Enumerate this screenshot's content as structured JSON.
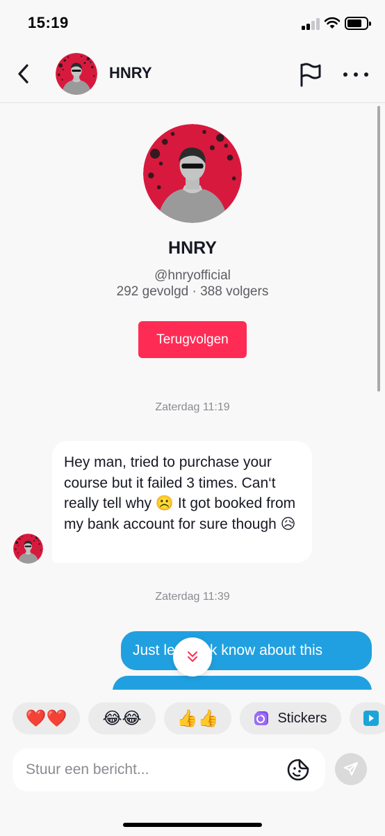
{
  "status_bar": {
    "time": "15:19"
  },
  "header": {
    "back_icon": "chevron-left-icon",
    "name": "HNRY",
    "flag_icon": "flag-icon",
    "more_icon": "more-horizontal-icon"
  },
  "profile": {
    "name": "HNRY",
    "handle": "@hnryofficial",
    "stats": "292 gevolgd · 388 volgers",
    "follow_back_label": "Terugvolgen"
  },
  "messages": {
    "timestamp_1": "Zaterdag 11:19",
    "incoming_text": "Hey man, tried to purchase your course but it failed 3 times. Can‘t really tell why ☹️ It got booked from my bank account for sure though 😥",
    "timestamp_2": "Zaterdag 11:39",
    "outgoing_1_text": "Just let tiktok know about this"
  },
  "quick_reactions": {
    "hearts": "❤️❤️",
    "laughing": "😂😂",
    "thumbs": "👍👍",
    "stickers_label": "Stickers"
  },
  "composer": {
    "placeholder": "Stuur een bericht..."
  },
  "colors": {
    "accent": "#fe2c55",
    "outgoing_bubble": "#20a0e0",
    "background": "#f8f8f8"
  }
}
